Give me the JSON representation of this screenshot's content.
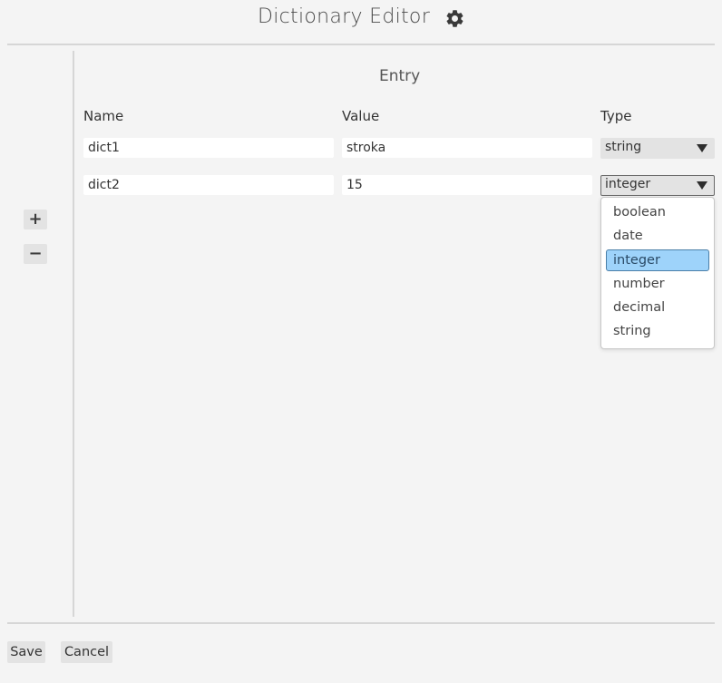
{
  "window": {
    "title": "Dictionary Editor"
  },
  "icons": {
    "settings": "gear-icon",
    "add": "plus-icon",
    "remove": "minus-icon",
    "dropdown": "triangle-down-icon"
  },
  "sidebar": {
    "add_label": "+",
    "remove_label": "−"
  },
  "entry": {
    "section_title": "Entry",
    "columns": {
      "name": "Name",
      "value": "Value",
      "type": "Type"
    },
    "rows": [
      {
        "name": "dict1",
        "value": "stroka",
        "type": "string"
      },
      {
        "name": "dict2",
        "value": "15",
        "type": "integer"
      }
    ]
  },
  "type_dropdown": {
    "open_for_row": 2,
    "selected": "integer",
    "options": [
      "boolean",
      "date",
      "integer",
      "number",
      "decimal",
      "string"
    ]
  },
  "footer": {
    "save_label": "Save",
    "cancel_label": "Cancel"
  },
  "colors": {
    "background": "#f4f4f4",
    "input_background": "#ffffff",
    "button_background": "#e3e3e3",
    "selection_highlight": "#9ed3fa",
    "selection_border": "#4b7fa8",
    "divider": "#d6d6d6"
  }
}
